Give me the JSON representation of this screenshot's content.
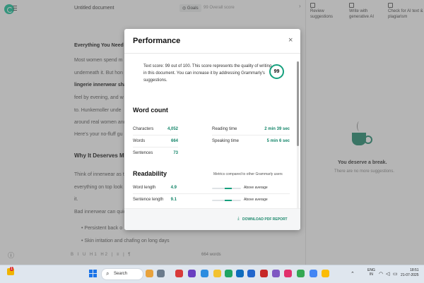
{
  "app": {
    "doc_title": "Untitled document",
    "goals_label": "Goals",
    "overall_score_label": "99 Overall score"
  },
  "editor": {
    "heading1": "Everything You Need",
    "p1": [
      "Most women spend m",
      "underneath it. But hon",
      "lingerie innerwear sha",
      "feel by evening, and w",
      "to. Hunkemoller unde",
      "around real women and",
      "Here's your no-fluff gu"
    ],
    "heading2": "Why It Deserves M",
    "p2": [
      "Think of innerwear as t",
      "everything on top look",
      "it."
    ],
    "p3": "Bad innerwear can quic",
    "bullets": [
      "Persistent back o",
      "Skin irritation and chafing on long days"
    ],
    "toolbar": "B  I  U  H1 H2  |  ≡  |  ¶",
    "word_count": "664 words"
  },
  "right_panel": {
    "tabs": [
      {
        "label": "Review suggestions"
      },
      {
        "label": "Write with generative AI"
      },
      {
        "label": "Check for AI text & plagiarism"
      }
    ],
    "break_title": "You deserve a break.",
    "break_sub": "There are no more suggestions."
  },
  "modal": {
    "title": "Performance",
    "close": "×",
    "score_text": "Text score: 99 out of 100. This score represents the quality of writing in this document. You can increase it by addressing Grammarly's suggestions.",
    "score": "99",
    "word_count_title": "Word count",
    "counts": [
      {
        "label": "Characters",
        "value": "4,052"
      },
      {
        "label": "Words",
        "value": "664"
      },
      {
        "label": "Sentences",
        "value": "73"
      }
    ],
    "times": [
      {
        "label": "Reading time",
        "value": "2 min 39 sec"
      },
      {
        "label": "Speaking time",
        "value": "5 min 6 sec"
      }
    ],
    "readability_title": "Readability",
    "metrics_note": "Metrics compared to other Grammarly users",
    "readability": [
      {
        "label": "Word length",
        "value": "4.9",
        "status": "Above average"
      },
      {
        "label": "Sentence length",
        "value": "9.1",
        "status": "Above average"
      }
    ],
    "download": "DOWNLOAD PDF REPORT"
  },
  "taskbar": {
    "weather_badge": "1",
    "search_label": "Search",
    "lang_line1": "ENG",
    "lang_line2": "IN",
    "time": "18:51",
    "date": "21-07-2025"
  },
  "colors": {
    "accent": "#15a07d",
    "value_green": "#15866a",
    "cup": "#1f8a6e"
  }
}
